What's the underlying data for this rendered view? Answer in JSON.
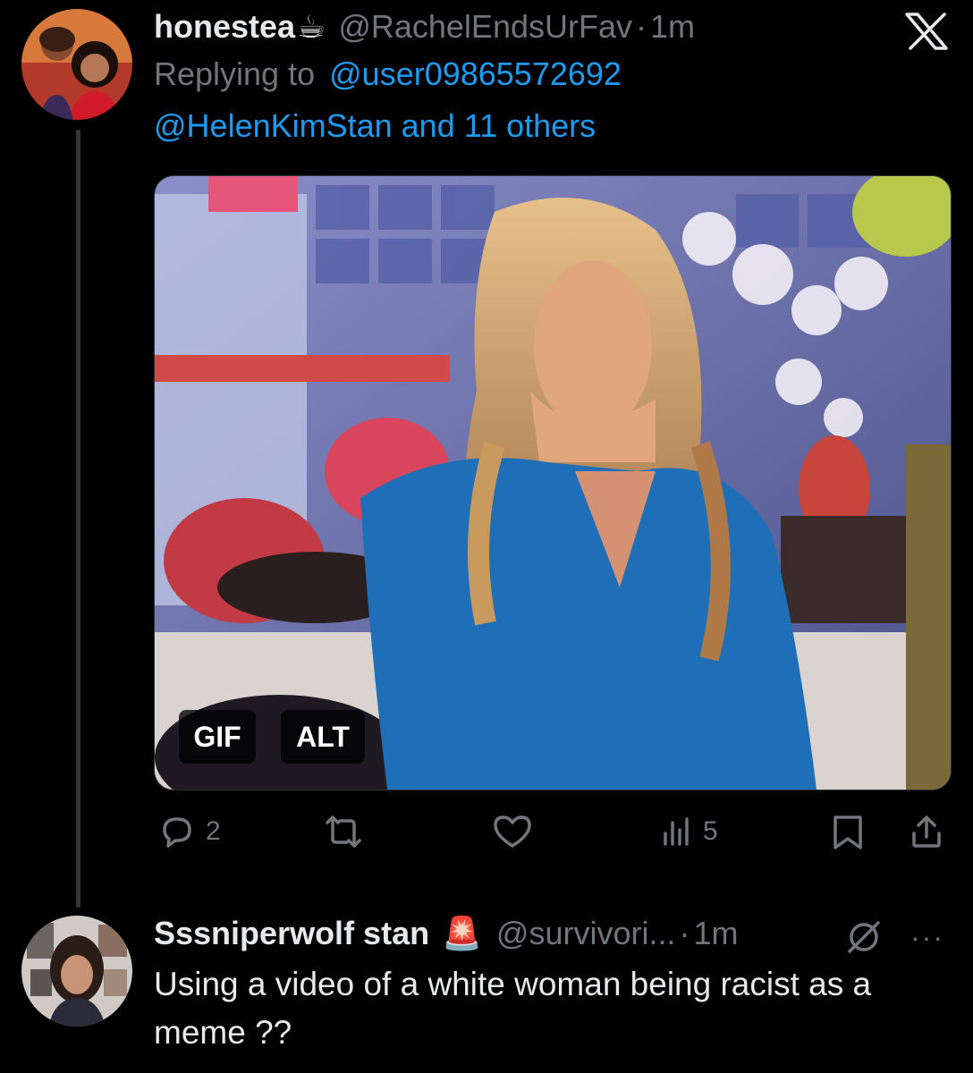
{
  "tweet": {
    "display_name": "honestea",
    "name_emoji": "☕",
    "handle": "@RachelEndsUrFav",
    "separator": "·",
    "time": "1m",
    "replying_prefix": "Replying to",
    "replying_to_first": "@user09865572692",
    "replying_to_rest": "@HelenKimStan and 11 others",
    "media": {
      "gif_badge": "GIF",
      "alt_badge": "ALT"
    },
    "actions": {
      "reply_count": "2",
      "retweet_count": "",
      "like_count": "",
      "views_count": "5"
    }
  },
  "reply": {
    "display_name": "Sssniperwolf stan",
    "name_emoji": "🚨",
    "handle": "@survivori...",
    "separator": "·",
    "time": "1m",
    "more": "···",
    "text": "Using a video of a white woman being racist as a meme ??"
  },
  "icons": {
    "close": "x-logo-icon",
    "reply": "comment-bubble-icon",
    "retweet": "retweet-icon",
    "like": "heart-icon",
    "views": "bar-chart-icon",
    "bookmark": "bookmark-icon",
    "share": "share-upload-icon",
    "mute": "mute-circle-slash-icon"
  },
  "colors": {
    "background": "#000000",
    "text": "#e7e9ea",
    "muted": "#71767b",
    "link": "#1d9bf0"
  }
}
